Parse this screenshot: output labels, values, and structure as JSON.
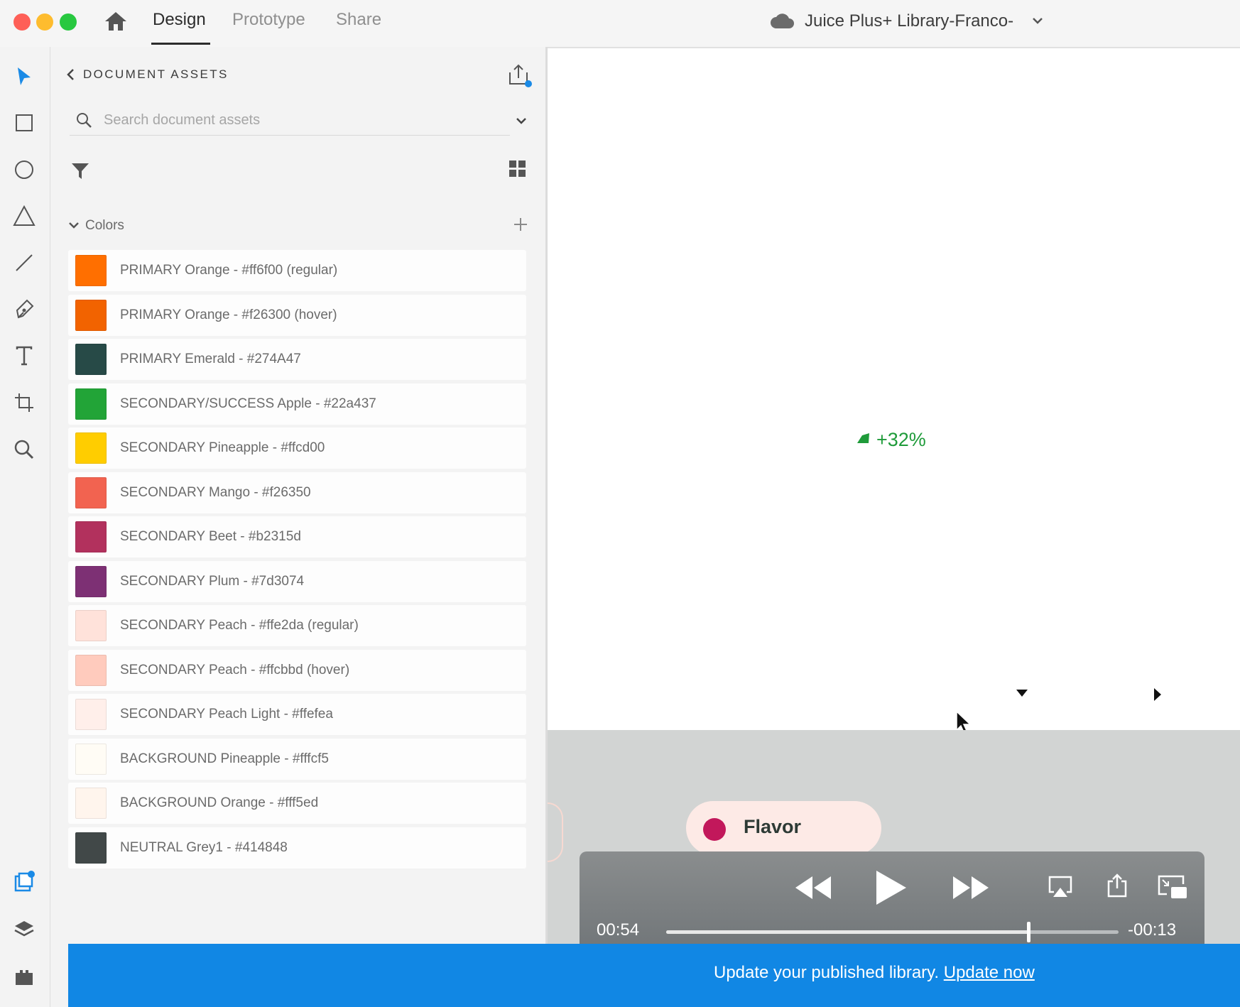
{
  "window": {
    "title": "Juice Plus+ Library-Franco-",
    "tabs": [
      "Design",
      "Prototype",
      "Share"
    ],
    "active_tab": "Design"
  },
  "assets_panel": {
    "title": "DOCUMENT ASSETS",
    "search_placeholder": "Search document assets",
    "colors_section_label": "Colors",
    "colors": [
      {
        "label": "PRIMARY Orange - #ff6f00 (regular)",
        "hex": "#ff6f00"
      },
      {
        "label": "PRIMARY Orange - #f26300 (hover)",
        "hex": "#f26300"
      },
      {
        "label": "PRIMARY Emerald - #274A47",
        "hex": "#274A47"
      },
      {
        "label": "SECONDARY/SUCCESS Apple - #22a437",
        "hex": "#22a437"
      },
      {
        "label": "SECONDARY Pineapple - #ffcd00",
        "hex": "#ffcd00"
      },
      {
        "label": "SECONDARY Mango - #f26350",
        "hex": "#f26350"
      },
      {
        "label": "SECONDARY Beet - #b2315d",
        "hex": "#b2315d"
      },
      {
        "label": "SECONDARY Plum - #7d3074",
        "hex": "#7d3074"
      },
      {
        "label": "SECONDARY Peach - #ffe2da (regular)",
        "hex": "#ffe2da"
      },
      {
        "label": "SECONDARY Peach - #ffcbbd (hover)",
        "hex": "#ffcbbd"
      },
      {
        "label": "SECONDARY Peach Light - #ffefea",
        "hex": "#ffefea"
      },
      {
        "label": "BACKGROUND Pineapple - #fffcf5",
        "hex": "#fffcf5"
      },
      {
        "label": "BACKGROUND Orange - #fff5ed",
        "hex": "#fff5ed"
      },
      {
        "label": "NEUTRAL Grey1 - #414848",
        "hex": "#414848"
      }
    ]
  },
  "canvas": {
    "percentage_text": "+32%",
    "flavor_label": "Flavor"
  },
  "player": {
    "elapsed": "00:54",
    "remaining": "-00:13",
    "progress_fraction": 0.8
  },
  "banner": {
    "message": "Update your published library.",
    "link": "Update now"
  },
  "icons": {
    "home": "home-icon",
    "cloud": "cloud-icon",
    "select": "select-arrow-icon",
    "rectangle": "rectangle-icon",
    "ellipse": "ellipse-icon",
    "polygon": "triangle-icon",
    "line": "line-icon",
    "pen": "pen-icon",
    "text": "text-icon",
    "artboard": "artboard-icon",
    "zoom": "zoom-icon",
    "assets": "assets-icon",
    "layers": "layers-icon",
    "plugins": "plugins-icon",
    "filter": "filter-icon",
    "grid": "grid-view-icon",
    "share": "share-icon"
  },
  "colors": {
    "accent": "#1187e4",
    "success": "#1f9b3a"
  }
}
